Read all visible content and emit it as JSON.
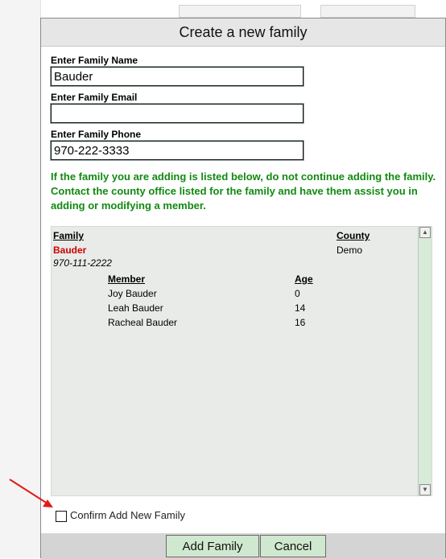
{
  "dialog": {
    "title": "Create a new family",
    "fields": [
      {
        "label": "Enter Family Name",
        "value": "Bauder"
      },
      {
        "label": "Enter Family Email",
        "value": ""
      },
      {
        "label": "Enter Family Phone",
        "value": "970-222-3333"
      }
    ],
    "warning": "If the family you are adding is listed below, do not continue adding the family. Contact the county office listed for the family and have them assist you in adding or modifying a member.",
    "list": {
      "family_header": "Family",
      "county_header": "County",
      "family_name": "Bauder",
      "county": "Demo",
      "phone": "970-111-2222",
      "member_header": "Member",
      "age_header": "Age",
      "members": [
        {
          "name": "Joy Bauder",
          "age": "0"
        },
        {
          "name": "Leah Bauder",
          "age": "14"
        },
        {
          "name": "Racheal Bauder",
          "age": "16"
        }
      ]
    },
    "confirm_label": "Confirm Add New Family",
    "buttons": {
      "add": "Add Family",
      "cancel": "Cancel"
    }
  },
  "colors": {
    "warning": "#118a11",
    "family_name": "#cc0000",
    "button": "#cfe8cf",
    "arrow": "#e21a1a"
  },
  "icons": {
    "scroll_up": "triangle-up",
    "scroll_down": "triangle-down",
    "annotation": "red-arrow"
  }
}
